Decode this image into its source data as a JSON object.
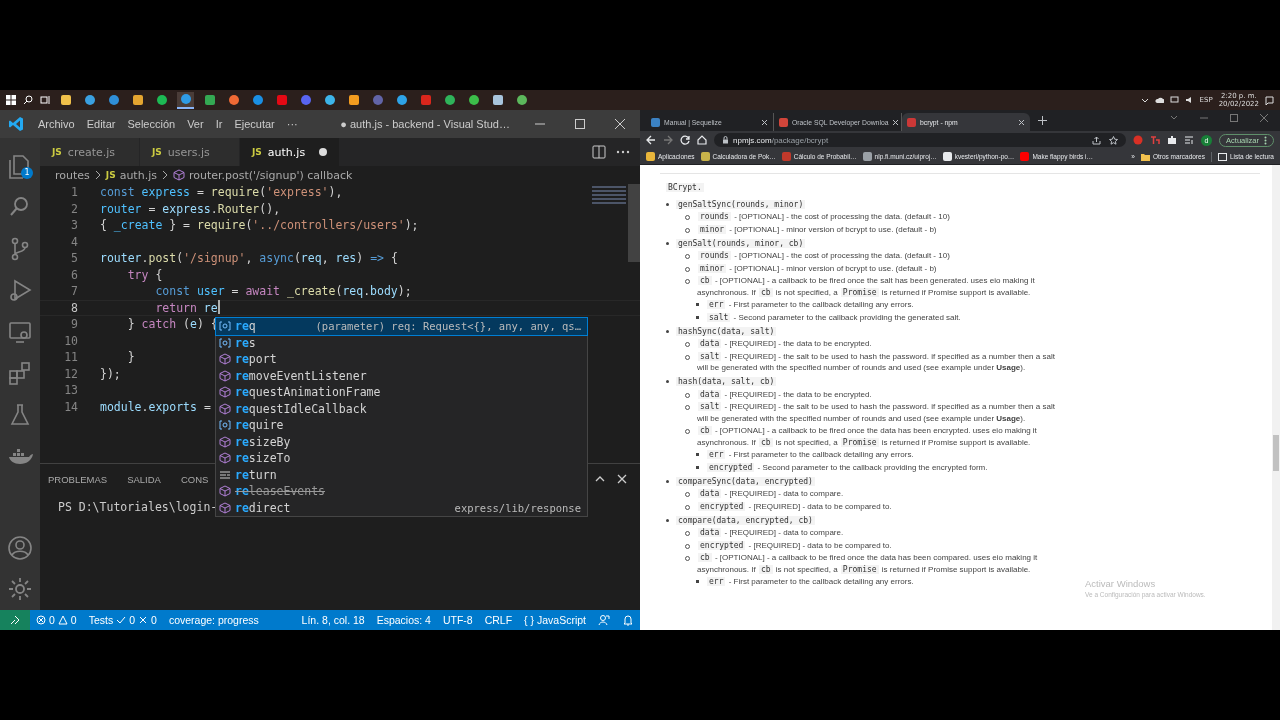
{
  "taskbar": {
    "apps": [
      {
        "color": "#f0c04a",
        "selected": false
      },
      {
        "color": "#3aa0e0",
        "selected": false
      },
      {
        "color": "#2f8fd8",
        "selected": false
      },
      {
        "color": "#e5a530",
        "selected": false
      },
      {
        "color": "#1db954",
        "selected": false
      },
      {
        "color": "#2f9be6",
        "selected": true
      },
      {
        "color": "#34a853",
        "selected": false
      },
      {
        "color": "#f06a35",
        "selected": false
      },
      {
        "color": "#1a8fe3",
        "selected": false
      },
      {
        "color": "#e50914",
        "selected": false
      },
      {
        "color": "#5865f2",
        "selected": false
      },
      {
        "color": "#3db4e8",
        "selected": false
      },
      {
        "color": "#f39c1f",
        "selected": false
      },
      {
        "color": "#6264a7",
        "selected": false
      },
      {
        "color": "#2ea3e8",
        "selected": false
      },
      {
        "color": "#d9261c",
        "selected": false
      },
      {
        "color": "#2fb35a",
        "selected": false
      },
      {
        "color": "#3cbd4a",
        "selected": false
      },
      {
        "color": "#a8c4dc",
        "selected": false
      },
      {
        "color": "#5cb85c",
        "selected": false
      }
    ],
    "language": "ESP",
    "time": "2:20 p. m.",
    "date": "20/02/2022"
  },
  "vscode": {
    "menu": [
      "Archivo",
      "Editar",
      "Selección",
      "Ver",
      "Ir",
      "Ejecutar",
      "···"
    ],
    "title": "● auth.js - backend - Visual Stud…",
    "activity": [
      {
        "kind": "explorer",
        "badge": "1"
      },
      {
        "kind": "search"
      },
      {
        "kind": "scm"
      },
      {
        "kind": "debug"
      },
      {
        "kind": "remote"
      },
      {
        "kind": "extensions"
      },
      {
        "kind": "testing"
      },
      {
        "kind": "docker"
      }
    ],
    "activity_bottom": [
      {
        "kind": "account"
      },
      {
        "kind": "settings"
      }
    ],
    "tabs": [
      {
        "icon": "JS",
        "label": "create.js",
        "selected": false,
        "modified": false
      },
      {
        "icon": "JS",
        "label": "users.js",
        "selected": false,
        "modified": false
      },
      {
        "icon": "JS",
        "label": "auth.js",
        "selected": true,
        "modified": true
      }
    ],
    "breadcrumb": {
      "folder": "routes",
      "file_icon": "JS",
      "file": "auth.js",
      "symbol": "router.post('/signup') callback"
    },
    "lines": [
      {
        "number": "1",
        "current": false,
        "tokens": [
          {
            "kind": "kw",
            "text": "const"
          },
          {
            "kind": "const",
            "text": " express"
          },
          {
            "kind": "plain",
            "text": " = "
          },
          {
            "kind": "fn",
            "text": "require"
          },
          {
            "kind": "plain",
            "text": "("
          },
          {
            "kind": "str",
            "text": "'express'"
          },
          {
            "kind": "plain",
            "text": "),"
          }
        ]
      },
      {
        "number": "2",
        "current": false,
        "tokens": [
          {
            "kind": "const",
            "text": "router"
          },
          {
            "kind": "plain",
            "text": " = "
          },
          {
            "kind": "var",
            "text": "express"
          },
          {
            "kind": "plain",
            "text": "."
          },
          {
            "kind": "fn",
            "text": "Router"
          },
          {
            "kind": "plain",
            "text": "(),"
          }
        ]
      },
      {
        "number": "3",
        "current": false,
        "tokens": [
          {
            "kind": "plain",
            "text": "{ "
          },
          {
            "kind": "const",
            "text": "_create"
          },
          {
            "kind": "plain",
            "text": " } = "
          },
          {
            "kind": "fn",
            "text": "require"
          },
          {
            "kind": "plain",
            "text": "("
          },
          {
            "kind": "str",
            "text": "'../controllers/users'"
          },
          {
            "kind": "plain",
            "text": ");"
          }
        ]
      },
      {
        "number": "4",
        "current": false
      },
      {
        "number": "5",
        "current": false,
        "tokens": [
          {
            "kind": "var",
            "text": "router"
          },
          {
            "kind": "plain",
            "text": "."
          },
          {
            "kind": "fn",
            "text": "post"
          },
          {
            "kind": "plain",
            "text": "("
          },
          {
            "kind": "str",
            "text": "'/signup'"
          },
          {
            "kind": "plain",
            "text": ", "
          },
          {
            "kind": "kw",
            "text": "async"
          },
          {
            "kind": "plain",
            "text": "("
          },
          {
            "kind": "var",
            "text": "req"
          },
          {
            "kind": "plain",
            "text": ", "
          },
          {
            "kind": "var",
            "text": "res"
          },
          {
            "kind": "plain",
            "text": ") "
          },
          {
            "kind": "kw",
            "text": "=>"
          },
          {
            "kind": "plain",
            "text": " {"
          }
        ]
      },
      {
        "number": "6",
        "current": false,
        "tokens": [
          {
            "kind": "ctrl",
            "text": "    try"
          },
          {
            "kind": "plain",
            "text": " {"
          }
        ]
      },
      {
        "number": "7",
        "current": false,
        "tokens": [
          {
            "kind": "kw",
            "text": "        const"
          },
          {
            "kind": "const",
            "text": " user"
          },
          {
            "kind": "plain",
            "text": " = "
          },
          {
            "kind": "ctrl",
            "text": "await"
          },
          {
            "kind": "fn",
            "text": " _create"
          },
          {
            "kind": "plain",
            "text": "("
          },
          {
            "kind": "var",
            "text": "req"
          },
          {
            "kind": "plain",
            "text": "."
          },
          {
            "kind": "var",
            "text": "body"
          },
          {
            "kind": "plain",
            "text": ");"
          }
        ]
      },
      {
        "number": "8",
        "current": true,
        "tokens": [
          {
            "kind": "ctrl",
            "text": "        return"
          },
          {
            "kind": "var",
            "text": " re"
          }
        ]
      },
      {
        "number": "9",
        "current": false,
        "tokens": [
          {
            "kind": "plain",
            "text": "    } "
          },
          {
            "kind": "ctrl",
            "text": "catch"
          },
          {
            "kind": "plain",
            "text": " ("
          },
          {
            "kind": "var",
            "text": "e"
          },
          {
            "kind": "plain",
            "text": ") {"
          }
        ]
      },
      {
        "number": "10",
        "current": false
      },
      {
        "number": "11",
        "current": false,
        "tokens": [
          {
            "kind": "plain",
            "text": "    }"
          }
        ]
      },
      {
        "number": "12",
        "current": false,
        "tokens": [
          {
            "kind": "plain",
            "text": "});"
          }
        ]
      },
      {
        "number": "13",
        "current": false
      },
      {
        "number": "14",
        "current": false,
        "tokens": [
          {
            "kind": "var",
            "text": "module"
          },
          {
            "kind": "plain",
            "text": "."
          },
          {
            "kind": "var",
            "text": "exports"
          },
          {
            "kind": "plain",
            "text": " ="
          }
        ]
      }
    ],
    "suggestions": [
      {
        "kind": "variable",
        "match": "re",
        "rest": "q",
        "selected": true,
        "deprecated": false,
        "detail": "(parameter) req: Request<{}, any, any, qs…"
      },
      {
        "kind": "variable",
        "match": "re",
        "rest": "s",
        "selected": false,
        "deprecated": false
      },
      {
        "kind": "module",
        "match": "re",
        "rest": "port",
        "selected": false,
        "deprecated": false
      },
      {
        "kind": "module",
        "match": "re",
        "rest": "moveEventListener",
        "selected": false,
        "deprecated": false
      },
      {
        "kind": "module",
        "match": "re",
        "rest": "questAnimationFrame",
        "selected": false,
        "deprecated": false
      },
      {
        "kind": "module",
        "match": "re",
        "rest": "questIdleCallback",
        "selected": false,
        "deprecated": false
      },
      {
        "kind": "variable",
        "match": "re",
        "rest": "quire",
        "selected": false,
        "deprecated": false
      },
      {
        "kind": "module",
        "match": "re",
        "rest": "sizeBy",
        "selected": false,
        "deprecated": false
      },
      {
        "kind": "module",
        "match": "re",
        "rest": "sizeTo",
        "selected": false,
        "deprecated": false
      },
      {
        "kind": "keyword",
        "match": "re",
        "rest": "turn",
        "selected": false,
        "deprecated": false
      },
      {
        "kind": "module",
        "match": "re",
        "rest": "leaseEvents",
        "selected": false,
        "deprecated": true
      },
      {
        "kind": "module",
        "match": "re",
        "rest": "direct",
        "selected": false,
        "deprecated": false,
        "detail": "express/lib/response"
      }
    ],
    "panel": {
      "tabs": [
        "PROBLEMAS",
        "SALIDA",
        "CONS"
      ],
      "terminal": "PS D:\\Tutoriales\\login-"
    },
    "status": {
      "errors": "0",
      "warnings": "0",
      "tests": "Tests",
      "passed": "0",
      "failed": "0",
      "coverage": "coverage: progress",
      "position": "Lín. 8, col. 18",
      "indent": "Espacios: 4",
      "encoding": "UTF-8",
      "eol": "CRLF",
      "language_icon": "{ }",
      "language": "JavaScript"
    }
  },
  "browser": {
    "tabs": [
      {
        "label": "Manual | Sequelize",
        "selected": false,
        "color": "#3b82c4"
      },
      {
        "label": "Oracle SQL Developer Downloa",
        "selected": false,
        "color": "#d0453a"
      },
      {
        "label": "bcrypt - npm",
        "selected": true,
        "color": "#cb3837"
      }
    ],
    "url_host": "npmjs.com",
    "url_path": "/package/bcrypt",
    "profile_initial": "d",
    "update_button": "Actualizar",
    "bookmarks": [
      {
        "label": "Aplicaciones",
        "color": "#e9b63b"
      },
      {
        "label": "Calculadora de Pok…",
        "color": "#c8b34a"
      },
      {
        "label": "Cálculo de Probabil…",
        "color": "#c0392b"
      },
      {
        "label": "nlp.fi.muni.cz/uiproj…",
        "color": "#9aa0a6"
      },
      {
        "label": "kvesteri/python-po…",
        "color": "#e8eaed"
      },
      {
        "label": "Make flappy birds i…",
        "color": "#ff0000"
      }
    ],
    "more_bookmarks": "»",
    "other_bookmarks": "Otros marcadores",
    "reading_list": "Lista de lectura",
    "page": {
      "intro": "BCrypt.",
      "methods": [
        {
          "signature": "genSaltSync(rounds, minor)",
          "params": [
            {
              "text": [
                {
                  "kind": "code",
                  "text": "rounds"
                },
                {
                  "kind": "text",
                  "text": "- [OPTIONAL] - the cost of processing the data. (default - 10)"
                }
              ]
            },
            {
              "text": [
                {
                  "kind": "code",
                  "text": "minor"
                },
                {
                  "kind": "text",
                  "text": "- [OPTIONAL] - minor version of bcrypt to use. (default - b)"
                }
              ]
            }
          ]
        },
        {
          "signature": "genSalt(rounds, minor, cb)",
          "params": [
            {
              "text": [
                {
                  "kind": "code",
                  "text": "rounds"
                },
                {
                  "kind": "text",
                  "text": "- [OPTIONAL] - the cost of processing the data. (default - 10)"
                }
              ]
            },
            {
              "text": [
                {
                  "kind": "code",
                  "text": "minor"
                },
                {
                  "kind": "text",
                  "text": "- [OPTIONAL] - minor version of bcrypt to use. (default - b)"
                }
              ]
            },
            {
              "text": [
                {
                  "kind": "code",
                  "text": "cb"
                },
                {
                  "kind": "text",
                  "text": "- [OPTIONAL] - a callback to be fired once the salt has been generated. uses eio making it asynchronous. If"
                },
                {
                  "kind": "code",
                  "text": "cb"
                },
                {
                  "kind": "text",
                  "text": "is not specified, a"
                },
                {
                  "kind": "code",
                  "text": "Promise"
                },
                {
                  "kind": "text",
                  "text": "is returned if Promise support is available."
                }
              ],
              "children": [
                {
                  "text": [
                    {
                      "kind": "code",
                      "text": "err"
                    },
                    {
                      "kind": "text",
                      "text": "- First parameter to the callback detailing any errors."
                    }
                  ]
                },
                {
                  "text": [
                    {
                      "kind": "code",
                      "text": "salt"
                    },
                    {
                      "kind": "text",
                      "text": "- Second parameter to the callback providing the generated salt."
                    }
                  ]
                }
              ]
            }
          ]
        },
        {
          "signature": "hashSync(data, salt)",
          "params": [
            {
              "text": [
                {
                  "kind": "code",
                  "text": "data"
                },
                {
                  "kind": "text",
                  "text": "- [REQUIRED] - the data to be encrypted."
                }
              ]
            },
            {
              "text": [
                {
                  "kind": "code",
                  "text": "salt"
                },
                {
                  "kind": "text",
                  "text": "- [REQUIRED] - the salt to be used to hash the password. if specified as a number then a salt will be generated with the specified number of rounds and used (see example under **Usage**)."
                }
              ]
            }
          ]
        },
        {
          "signature": "hash(data, salt, cb)",
          "params": [
            {
              "text": [
                {
                  "kind": "code",
                  "text": "data"
                },
                {
                  "kind": "text",
                  "text": "- [REQUIRED] - the data to be encrypted."
                }
              ]
            },
            {
              "text": [
                {
                  "kind": "code",
                  "text": "salt"
                },
                {
                  "kind": "text",
                  "text": "- [REQUIRED] - the salt to be used to hash the password. if specified as a number then a salt will be generated with the specified number of rounds and used (see example under **Usage**)."
                }
              ]
            },
            {
              "text": [
                {
                  "kind": "code",
                  "text": "cb"
                },
                {
                  "kind": "text",
                  "text": "- [OPTIONAL] - a callback to be fired once the data has been encrypted. uses eio making it asynchronous. If"
                },
                {
                  "kind": "code",
                  "text": "cb"
                },
                {
                  "kind": "text",
                  "text": "is not specified, a"
                },
                {
                  "kind": "code",
                  "text": "Promise"
                },
                {
                  "kind": "text",
                  "text": "is returned if Promise support is available."
                }
              ],
              "children": [
                {
                  "text": [
                    {
                      "kind": "code",
                      "text": "err"
                    },
                    {
                      "kind": "text",
                      "text": "- First parameter to the callback detailing any errors."
                    }
                  ]
                },
                {
                  "text": [
                    {
                      "kind": "code",
                      "text": "encrypted"
                    },
                    {
                      "kind": "text",
                      "text": "- Second parameter to the callback providing the encrypted form."
                    }
                  ]
                }
              ]
            }
          ]
        },
        {
          "signature": "compareSync(data, encrypted)",
          "params": [
            {
              "text": [
                {
                  "kind": "code",
                  "text": "data"
                },
                {
                  "kind": "text",
                  "text": "- [REQUIRED] - data to compare."
                }
              ]
            },
            {
              "text": [
                {
                  "kind": "code",
                  "text": "encrypted"
                },
                {
                  "kind": "text",
                  "text": "- [REQUIRED] - data to be compared to."
                }
              ]
            }
          ]
        },
        {
          "signature": "compare(data, encrypted, cb)",
          "params": [
            {
              "text": [
                {
                  "kind": "code",
                  "text": "data"
                },
                {
                  "kind": "text",
                  "text": "- [REQUIRED] - data to compare."
                }
              ]
            },
            {
              "text": [
                {
                  "kind": "code",
                  "text": "encrypted"
                },
                {
                  "kind": "text",
                  "text": "- [REQUIRED] - data to be compared to."
                }
              ]
            },
            {
              "text": [
                {
                  "kind": "code",
                  "text": "cb"
                },
                {
                  "kind": "text",
                  "text": "- [OPTIONAL] - a callback to be fired once the data has been compared. uses eio making it asynchronous. If"
                },
                {
                  "kind": "code",
                  "text": "cb"
                },
                {
                  "kind": "text",
                  "text": "is not specified, a"
                },
                {
                  "kind": "code",
                  "text": "Promise"
                },
                {
                  "kind": "text",
                  "text": "is returned if Promise support is available."
                }
              ],
              "children": [
                {
                  "text": [
                    {
                      "kind": "code",
                      "text": "err"
                    },
                    {
                      "kind": "text",
                      "text": "- First parameter to the callback detailing any errors."
                    }
                  ]
                }
              ]
            }
          ]
        }
      ]
    }
  },
  "activation": {
    "title": "Activar Windows",
    "subtitle": "Ve a Configuración para activar Windows."
  }
}
